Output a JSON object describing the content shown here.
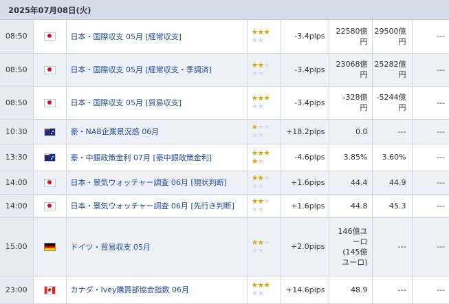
{
  "header": {
    "date": "2025年07月08日(火)"
  },
  "colors": {
    "star_on": "#e0a800",
    "star_off": "#d8dde6",
    "positive_pips": "#e0202a",
    "link": "#1f4b99"
  },
  "rows": [
    {
      "time": "08:50",
      "flag": "jp-flag-icon",
      "name": "日本・国際収支 05月 [経常収支]",
      "stars": 3,
      "pips": "-3.4pips",
      "positive": false,
      "prev": [
        "22580億",
        "円"
      ],
      "forecast": [
        "29500億",
        "円"
      ],
      "result": "---"
    },
    {
      "time": "08:50",
      "flag": "jp-flag-icon",
      "name": "日本・国際収支 05月 [経常収支・季調済]",
      "stars": 2,
      "pips": "-3.4pips",
      "positive": false,
      "prev": [
        "23068億",
        "円"
      ],
      "forecast": [
        "25282億",
        "円"
      ],
      "result": "---"
    },
    {
      "time": "08:50",
      "flag": "jp-flag-icon",
      "name": "日本・国際収支 05月 [貿易収支]",
      "stars": 3,
      "pips": "-3.4pips",
      "positive": false,
      "prev": [
        "-328億",
        "円"
      ],
      "forecast": [
        "-5244億",
        "円"
      ],
      "result": "---"
    },
    {
      "time": "10:30",
      "flag": "au-flag-icon",
      "name": "豪・NAB企業景況感 06月",
      "stars": 1,
      "pips": "+18.2pips",
      "positive": true,
      "prev": [
        "0.0"
      ],
      "forecast": [
        "---"
      ],
      "result": "---"
    },
    {
      "time": "13:30",
      "flag": "au-flag-icon",
      "name": "豪・中銀政策金利 07月 [豪中銀政策金利]",
      "stars": 4,
      "pips": "-4.6pips",
      "positive": false,
      "prev": [
        "3.85%"
      ],
      "forecast": [
        "3.60%"
      ],
      "result": "---"
    },
    {
      "time": "14:00",
      "flag": "jp-flag-icon",
      "name": "日本・景気ウォッチャー調査 06月 [現状判断]",
      "stars": 2,
      "pips": "+1.6pips",
      "positive": false,
      "prev": [
        "44.4"
      ],
      "forecast": [
        "44.9"
      ],
      "result": "---"
    },
    {
      "time": "14:00",
      "flag": "jp-flag-icon",
      "name": "日本・景気ウォッチャー調査 06月 [先行き判断]",
      "stars": 2,
      "pips": "+1.6pips",
      "positive": false,
      "prev": [
        "44.8"
      ],
      "forecast": [
        "45.3"
      ],
      "result": "---"
    },
    {
      "time": "15:00",
      "flag": "de-flag-icon",
      "name": "ドイツ・貿易収支 05月",
      "stars": 2,
      "pips": "+2.0pips",
      "positive": false,
      "prev": [
        "146億ユ",
        "ーロ",
        "(145億",
        "ユーロ)"
      ],
      "forecast": [
        "---"
      ],
      "result": "---"
    },
    {
      "time": "23:00",
      "flag": "ca-flag-icon",
      "name": "カナダ・Ivey購買部協会指数 06月",
      "stars": 3,
      "pips": "+14.6pips",
      "positive": true,
      "prev": [
        "48.9"
      ],
      "forecast": [
        "---"
      ],
      "result": "---"
    }
  ]
}
